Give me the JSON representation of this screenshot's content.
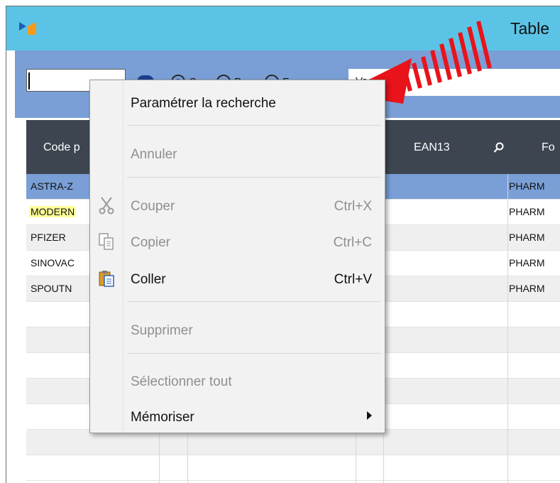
{
  "window": {
    "title": "Table"
  },
  "search": {
    "value": "",
    "filter_value": "Vaccins"
  },
  "radios": [
    {
      "label": "C",
      "checked": true
    },
    {
      "label": "P",
      "checked": false
    },
    {
      "label": "F",
      "checked": false
    }
  ],
  "grid": {
    "headers": {
      "code": "Code p",
      "ean": "EAN13",
      "four": "Fo"
    },
    "rows": [
      {
        "code": "ASTRA-Z",
        "four": "PHARM",
        "selected": true
      },
      {
        "code": "MODERN",
        "four": "PHARM",
        "highlight": true
      },
      {
        "code": "PFIZER",
        "four": "PHARM"
      },
      {
        "code": "SINOVAC",
        "four": "PHARM"
      },
      {
        "code": "SPOUTN",
        "four": "PHARM"
      }
    ]
  },
  "context_menu": {
    "items": [
      {
        "label": "Paramétrer la recherche",
        "enabled": true
      },
      {
        "label": "Annuler",
        "enabled": false
      },
      {
        "label": "Couper",
        "shortcut": "Ctrl+X",
        "enabled": false,
        "icon": "scissors-icon"
      },
      {
        "label": "Copier",
        "shortcut": "Ctrl+C",
        "enabled": false,
        "icon": "copy-icon"
      },
      {
        "label": "Coller",
        "shortcut": "Ctrl+V",
        "enabled": true,
        "icon": "paste-icon"
      },
      {
        "label": "Supprimer",
        "enabled": false
      },
      {
        "label": "Sélectionner tout",
        "enabled": false
      },
      {
        "label": "Mémoriser",
        "enabled": true,
        "submenu": true
      }
    ]
  },
  "colors": {
    "titlebar": "#5bc4e6",
    "toolbar": "#7a9fd6",
    "header": "#3d4650",
    "arrow": "#e8131b"
  }
}
